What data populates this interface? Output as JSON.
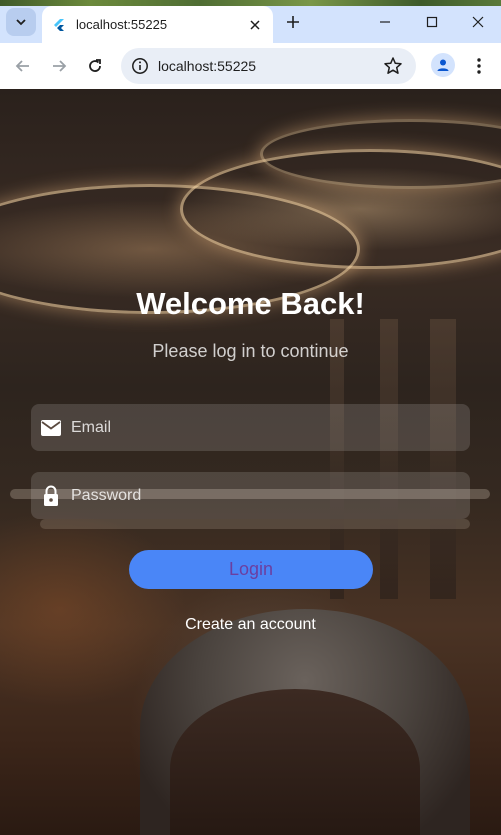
{
  "browser": {
    "tab": {
      "title": "localhost:55225"
    },
    "omnibox": {
      "url": "localhost:55225"
    },
    "icons": {
      "tab_search": "chevron-down-icon",
      "favicon": "flutter-icon",
      "tab_close": "close-icon",
      "new_tab": "plus-icon",
      "minimize": "minimize-icon",
      "maximize": "maximize-icon",
      "close_window": "close-icon",
      "back": "arrow-left-icon",
      "forward": "arrow-right-icon",
      "reload": "reload-icon",
      "site_info": "info-icon",
      "bookmark": "star-icon",
      "profile": "person-icon",
      "menu": "more-vertical-icon"
    }
  },
  "login": {
    "title": "Welcome Back!",
    "subtitle": "Please log in to continue",
    "email": {
      "placeholder": "Email",
      "icon": "mail-icon"
    },
    "password": {
      "placeholder": "Password",
      "icon": "lock-icon"
    },
    "login_label": "Login",
    "create_account_label": "Create an account"
  },
  "colors": {
    "button": "#4a86f7",
    "button_text": "#6b3fa0",
    "field_background": "rgba(255,255,255,0.14)",
    "tab_strip": "#d3e3fd"
  }
}
